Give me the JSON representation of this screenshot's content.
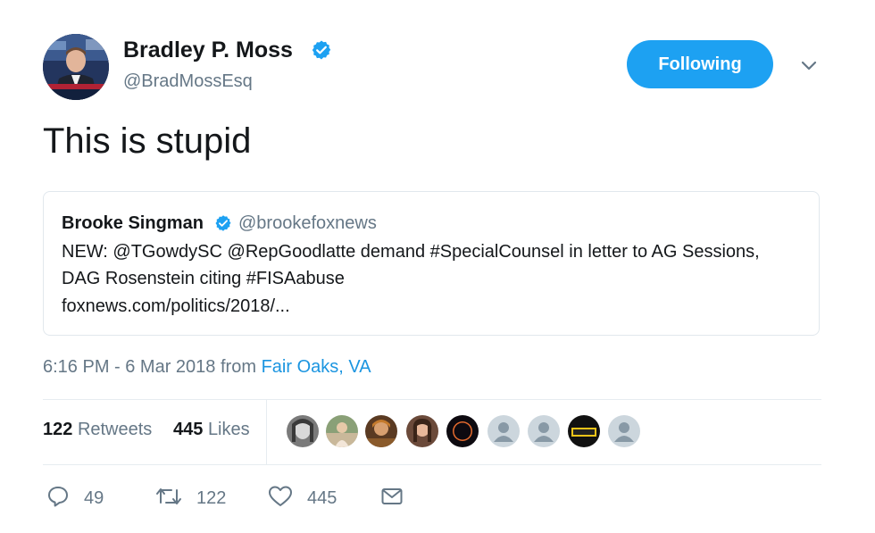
{
  "tweet": {
    "author": {
      "name": "Bradley P. Moss",
      "handle": "@BradMossEsq",
      "verified": true
    },
    "follow_button_label": "Following",
    "text": "This is stupid",
    "quoted": {
      "name": "Brooke Singman",
      "handle": "@brookefoxnews",
      "verified": true,
      "lines": [
        "NEW: @TGowdySC  @RepGoodlatte demand #SpecialCounsel in letter to AG Sessions,",
        "DAG Rosenstein citing #FISAabuse",
        "foxnews.com/politics/2018/..."
      ]
    },
    "timestamp": {
      "time_date": "6:16 PM - 6 Mar 2018",
      "from_label": "from",
      "location": "Fair Oaks, VA"
    },
    "stats": {
      "retweets_count": "122",
      "retweets_label": "Retweets",
      "likes_count": "445",
      "likes_label": "Likes"
    },
    "actions": {
      "reply_count": "49",
      "retweet_count": "122",
      "like_count": "445"
    }
  },
  "colors": {
    "accent": "#1da1f2",
    "link": "#1b95e0",
    "secondary_text": "#657786",
    "border": "#e1e8ed"
  },
  "icons": [
    "verified-icon",
    "chevron-down-icon",
    "reply-icon",
    "retweet-icon",
    "heart-icon",
    "message-icon"
  ]
}
